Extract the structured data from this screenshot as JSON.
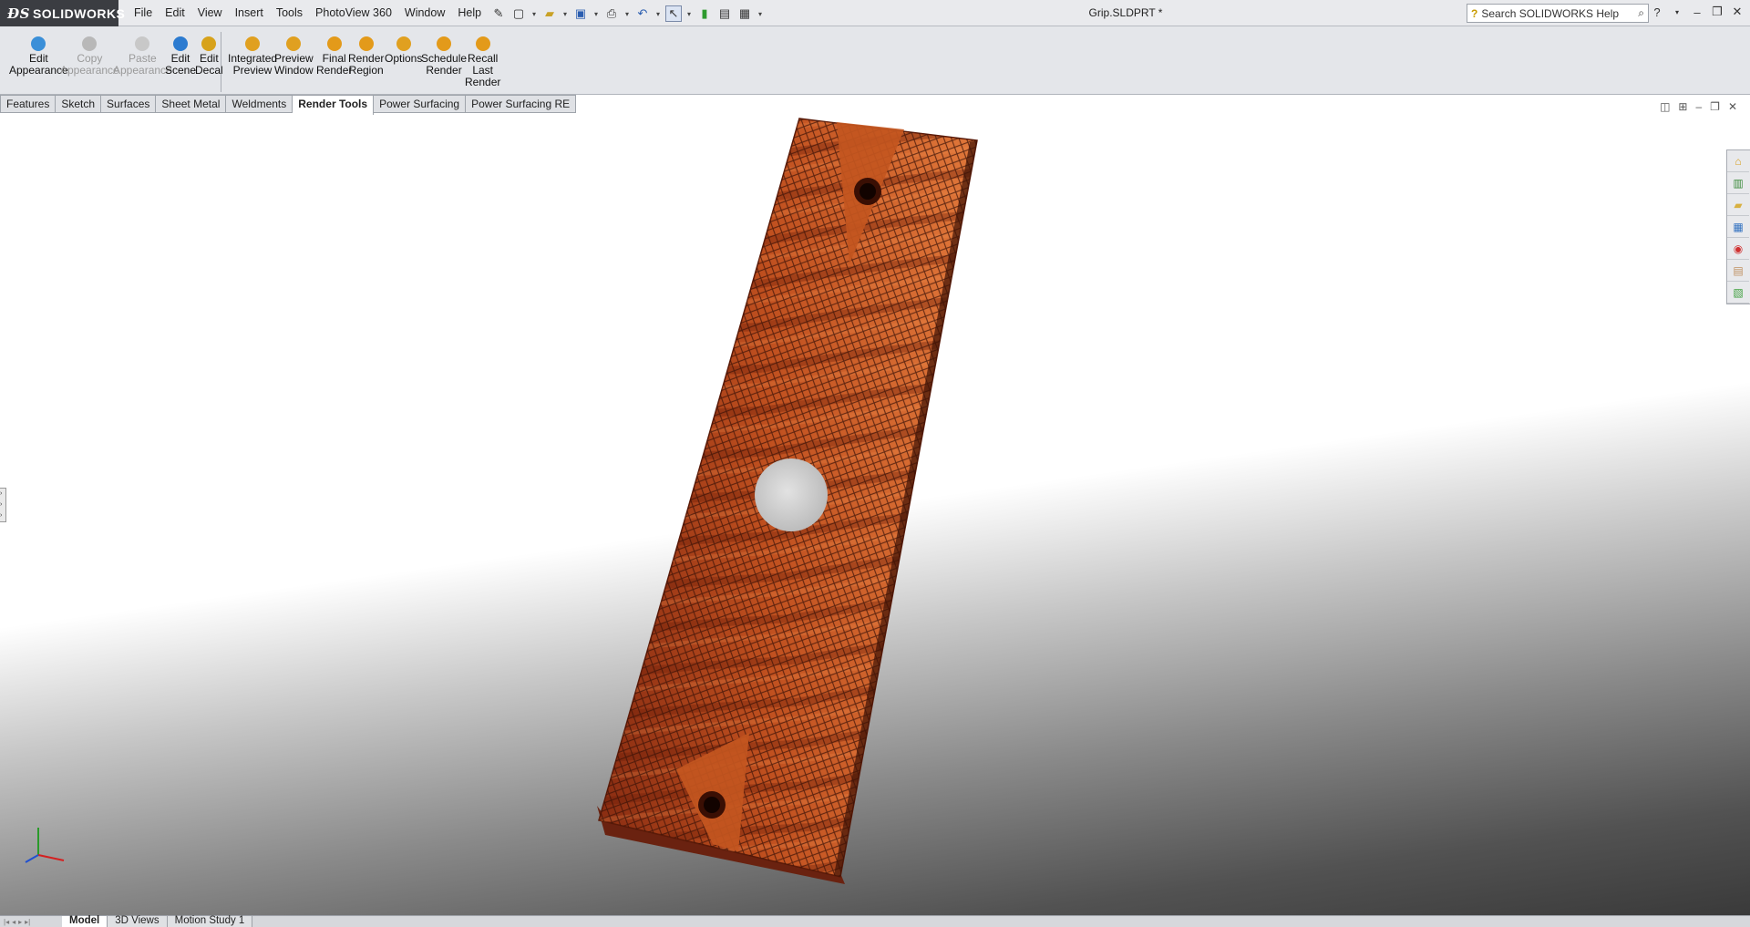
{
  "app": {
    "brand": "SOLIDWORKS",
    "document_title": "Grip.SLDPRT *"
  },
  "menu": [
    "File",
    "Edit",
    "View",
    "Insert",
    "Tools",
    "PhotoView 360",
    "Window",
    "Help"
  ],
  "search": {
    "placeholder": "Search SOLIDWORKS Help"
  },
  "commands": [
    {
      "label_1": "Edit",
      "label_2": "Appearance",
      "label_3": "",
      "enabled": true,
      "icon": "appearance-icon",
      "color": "#3a8fd8"
    },
    {
      "label_1": "Copy",
      "label_2": "Appearance",
      "label_3": "",
      "enabled": false,
      "icon": "copy-appearance-icon",
      "color": "#b8b8b8"
    },
    {
      "label_1": "Paste",
      "label_2": "Appearance",
      "label_3": "",
      "enabled": false,
      "icon": "paste-appearance-icon",
      "color": "#c8c8c8"
    },
    {
      "label_1": "Edit",
      "label_2": "Scene",
      "label_3": "",
      "enabled": true,
      "icon": "scene-icon",
      "color": "#2c7bd0"
    },
    {
      "label_1": "Edit",
      "label_2": "Decal",
      "label_3": "",
      "enabled": true,
      "icon": "decal-icon",
      "color": "#d7a21b"
    },
    {
      "label_1": "Integrated",
      "label_2": "Preview",
      "label_3": "",
      "enabled": true,
      "icon": "integrated-preview-icon",
      "color": "#e0a020"
    },
    {
      "label_1": "Preview",
      "label_2": "Window",
      "label_3": "",
      "enabled": true,
      "icon": "preview-window-icon",
      "color": "#e0a020"
    },
    {
      "label_1": "Final",
      "label_2": "Render",
      "label_3": "",
      "enabled": true,
      "icon": "final-render-icon",
      "color": "#e39a1a"
    },
    {
      "label_1": "Render",
      "label_2": "Region",
      "label_3": "",
      "enabled": true,
      "icon": "render-region-icon",
      "color": "#e39a1a"
    },
    {
      "label_1": "Options",
      "label_2": "",
      "label_3": "",
      "enabled": true,
      "icon": "options-icon",
      "color": "#e0a020"
    },
    {
      "label_1": "Schedule",
      "label_2": "Render",
      "label_3": "",
      "enabled": true,
      "icon": "schedule-render-icon",
      "color": "#e39a1a"
    },
    {
      "label_1": "Recall",
      "label_2": "Last",
      "label_3": "Render",
      "enabled": true,
      "icon": "recall-render-icon",
      "color": "#e39a1a"
    }
  ],
  "tabs": [
    {
      "label": "Features",
      "active": false
    },
    {
      "label": "Sketch",
      "active": false
    },
    {
      "label": "Surfaces",
      "active": false
    },
    {
      "label": "Sheet Metal",
      "active": false
    },
    {
      "label": "Weldments",
      "active": false
    },
    {
      "label": "Render Tools",
      "active": true
    },
    {
      "label": "Power Surfacing",
      "active": false
    },
    {
      "label": "Power Surfacing RE",
      "active": false
    }
  ],
  "task_pane": [
    "home-icon",
    "design-library-icon",
    "file-explorer-icon",
    "view-palette-icon",
    "appearances-icon",
    "custom-properties-icon",
    "forum-icon"
  ],
  "bottom_tabs": [
    {
      "label": "Model",
      "active": true
    },
    {
      "label": "3D Views",
      "active": false
    },
    {
      "label": "Motion Study 1",
      "active": false
    }
  ],
  "colors": {
    "wood_dark": "#8a2d12",
    "wood_mid": "#c0501f",
    "wood_light": "#e0773a",
    "accent_brand": "#3b3d42"
  }
}
